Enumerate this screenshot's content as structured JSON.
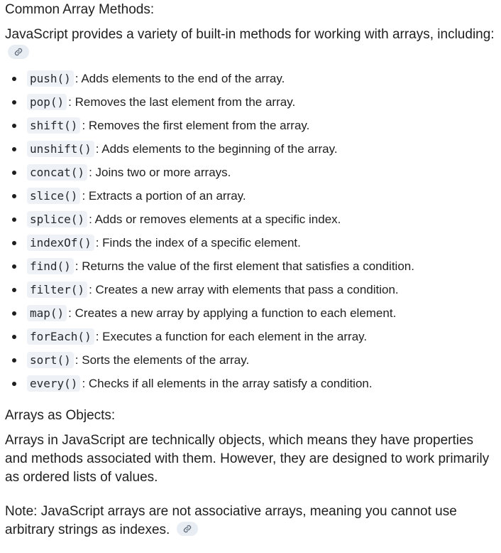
{
  "heading_methods": "Common Array Methods:",
  "intro_text": "JavaScript provides a variety of built-in methods for working with arrays, including:",
  "methods": [
    {
      "name": "push()",
      "desc": "Adds elements to the end of the array."
    },
    {
      "name": "pop()",
      "desc": "Removes the last element from the array."
    },
    {
      "name": "shift()",
      "desc": "Removes the first element from the array."
    },
    {
      "name": "unshift()",
      "desc": "Adds elements to the beginning of the array."
    },
    {
      "name": "concat()",
      "desc": "Joins two or more arrays."
    },
    {
      "name": "slice()",
      "desc": "Extracts a portion of an array."
    },
    {
      "name": "splice()",
      "desc": "Adds or removes elements at a specific index."
    },
    {
      "name": "indexOf()",
      "desc": "Finds the index of a specific element."
    },
    {
      "name": "find()",
      "desc": "Returns the value of the first element that satisfies a condition."
    },
    {
      "name": "filter()",
      "desc": "Creates a new array with elements that pass a condition."
    },
    {
      "name": "map()",
      "desc": "Creates a new array by applying a function to each element."
    },
    {
      "name": "forEach()",
      "desc": "Executes a function for each element in the array."
    },
    {
      "name": "sort()",
      "desc": "Sorts the elements of the array."
    },
    {
      "name": "every()",
      "desc": "Checks if all elements in the array satisfy a condition."
    }
  ],
  "separator": ":",
  "heading_objects": "Arrays as Objects:",
  "objects_text": "Arrays in JavaScript are technically objects, which means they have properties and methods associated with them. However, they are designed to work primarily as ordered lists of values.",
  "note_text": "Note: JavaScript arrays are not associative arrays, meaning you cannot use arbitrary strings as indexes.",
  "icons": {
    "source_link": "link-icon"
  }
}
